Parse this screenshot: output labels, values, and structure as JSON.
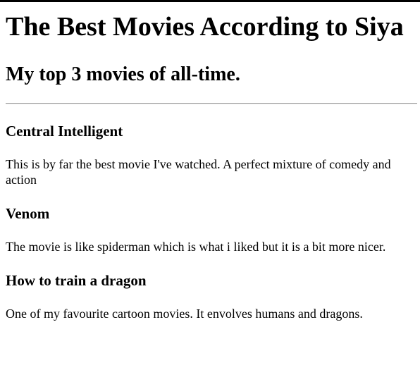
{
  "page": {
    "title": "The Best Movies According to Siya",
    "subtitle": "My top 3 movies of all-time."
  },
  "movies": [
    {
      "name": "Central Intelligent",
      "description": "This is by far the best movie I've watched. A perfect mixture of comedy and action"
    },
    {
      "name": "Venom",
      "description": "The movie is like spiderman which is what i liked but it is a bit more nicer."
    },
    {
      "name": "How to train a dragon",
      "description": "One of my favourite cartoon movies. It envolves humans and dragons."
    }
  ]
}
